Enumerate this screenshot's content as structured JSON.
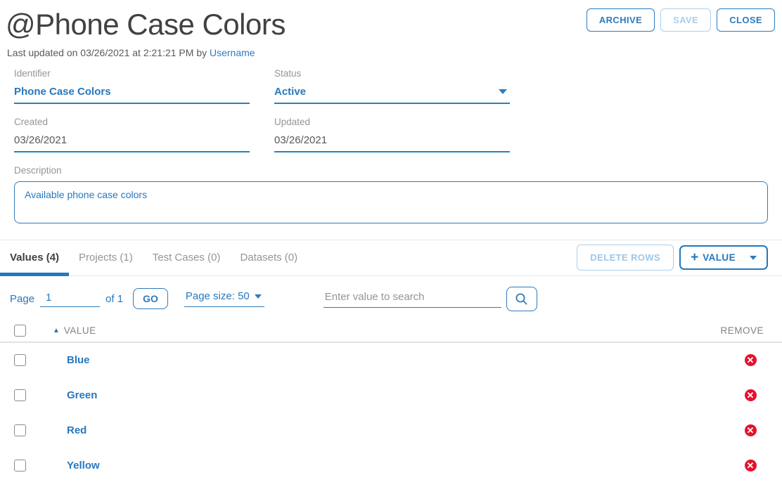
{
  "page": {
    "title": "@Phone Case Colors",
    "last_updated_prefix": "Last updated on 03/26/2021 at 2:21:21 PM by ",
    "updated_by": "Username"
  },
  "actions": {
    "archive": "ARCHIVE",
    "save": "SAVE",
    "close": "CLOSE"
  },
  "form": {
    "identifier": {
      "label": "Identifier",
      "value": "Phone Case Colors"
    },
    "status": {
      "label": "Status",
      "value": "Active"
    },
    "created": {
      "label": "Created",
      "value": "03/26/2021"
    },
    "updated": {
      "label": "Updated",
      "value": "03/26/2021"
    },
    "description": {
      "label": "Description",
      "value": "Available phone case colors"
    }
  },
  "tabs": [
    {
      "label": "Values (4)",
      "active": true
    },
    {
      "label": "Projects (1)",
      "active": false
    },
    {
      "label": "Test Cases (0)",
      "active": false
    },
    {
      "label": "Datasets (0)",
      "active": false
    }
  ],
  "table_actions": {
    "delete_rows": "DELETE ROWS",
    "add_plus": "+",
    "add_value": "VALUE"
  },
  "pagination": {
    "page_label": "Page",
    "page_value": "1",
    "of_label": "of 1",
    "go_label": "GO",
    "page_size_label": "Page size: 50",
    "search_placeholder": "Enter value to search"
  },
  "table": {
    "headers": {
      "value": "VALUE",
      "remove": "REMOVE"
    },
    "rows": [
      {
        "value": "Blue"
      },
      {
        "value": "Green"
      },
      {
        "value": "Red"
      },
      {
        "value": "Yellow"
      }
    ],
    "remove_glyph": "✕"
  },
  "colors": {
    "accent_blue": "#2178be",
    "link_blue": "#2e7bbd",
    "disabled_blue": "#9fc6e8",
    "label_gray": "#939598",
    "title_gray": "#414042",
    "remove_red": "#e8112d"
  }
}
